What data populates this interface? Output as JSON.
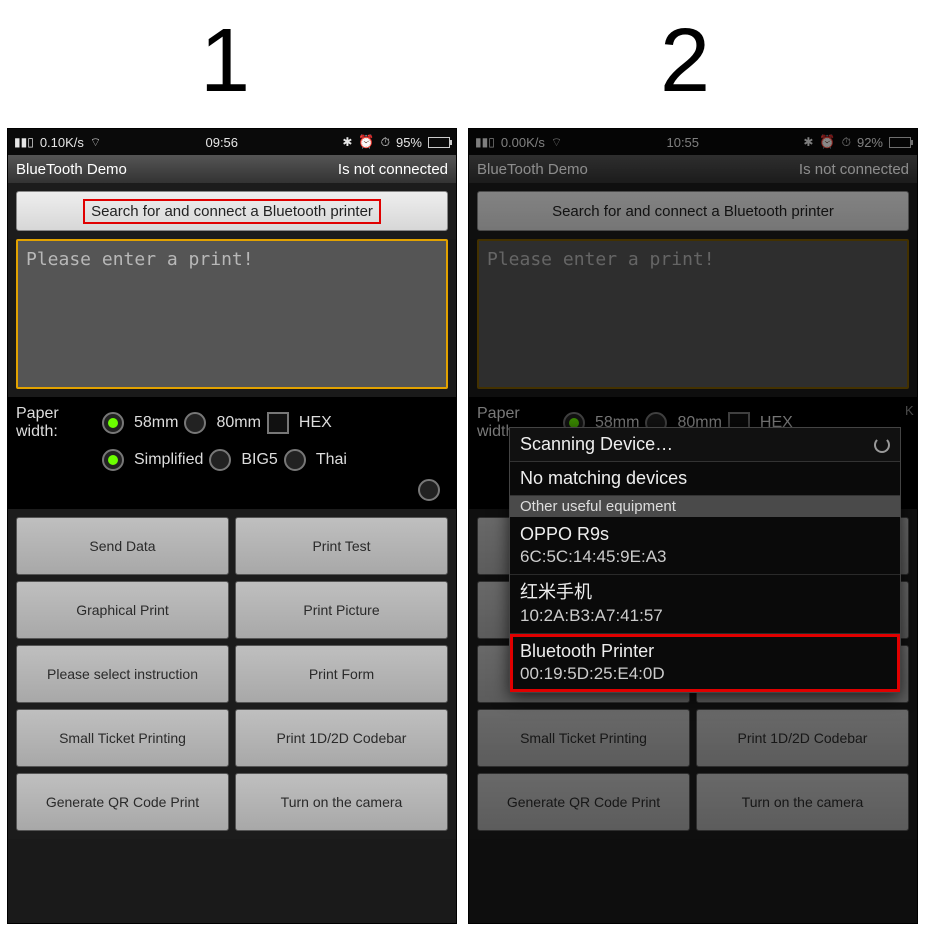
{
  "steps": {
    "one": "1",
    "two": "2"
  },
  "phone1": {
    "statusbar": {
      "net": "0.10K/s",
      "time": "09:56",
      "battery": "95%",
      "battery_fill": "95%"
    },
    "title": "BlueTooth Demo",
    "conn_status": "Is not connected",
    "search_label": "Search for and connect a Bluetooth printer",
    "input_placeholder": "Please enter a print!",
    "paper_width_label": "Paper width:",
    "pw_58": "58mm",
    "pw_80": "80mm",
    "hex": "HEX",
    "enc_simplified": "Simplified",
    "enc_big5": "BIG5",
    "enc_thai": "Thai",
    "buttons": [
      "Send Data",
      "Print Test",
      "Graphical Print",
      "Print Picture",
      "Please select instruction",
      "Print Form",
      "Small Ticket Printing",
      "Print 1D/2D Codebar",
      "Generate QR Code Print",
      "Turn on the camera"
    ]
  },
  "phone2": {
    "statusbar": {
      "net": "0.00K/s",
      "time": "10:55",
      "battery": "92%",
      "battery_fill": "92%"
    },
    "title": "BlueTooth Demo",
    "conn_status": "Is not connected",
    "search_label": "Search for and connect a Bluetooth printer",
    "input_placeholder": "Please enter a print!",
    "paper_width_label": "Paper width:",
    "buttons_partial_left": "K",
    "dialog": {
      "header": "Scanning Device…",
      "no_match": "No matching devices",
      "other_label": "Other useful equipment",
      "items": [
        {
          "name": "OPPO R9s",
          "mac": "6C:5C:14:45:9E:A3"
        },
        {
          "name": "红米手机",
          "mac": "10:2A:B3:A7:41:57"
        },
        {
          "name": "Bluetooth Printer",
          "mac": "00:19:5D:25:E4:0D",
          "highlight": true
        }
      ]
    }
  }
}
